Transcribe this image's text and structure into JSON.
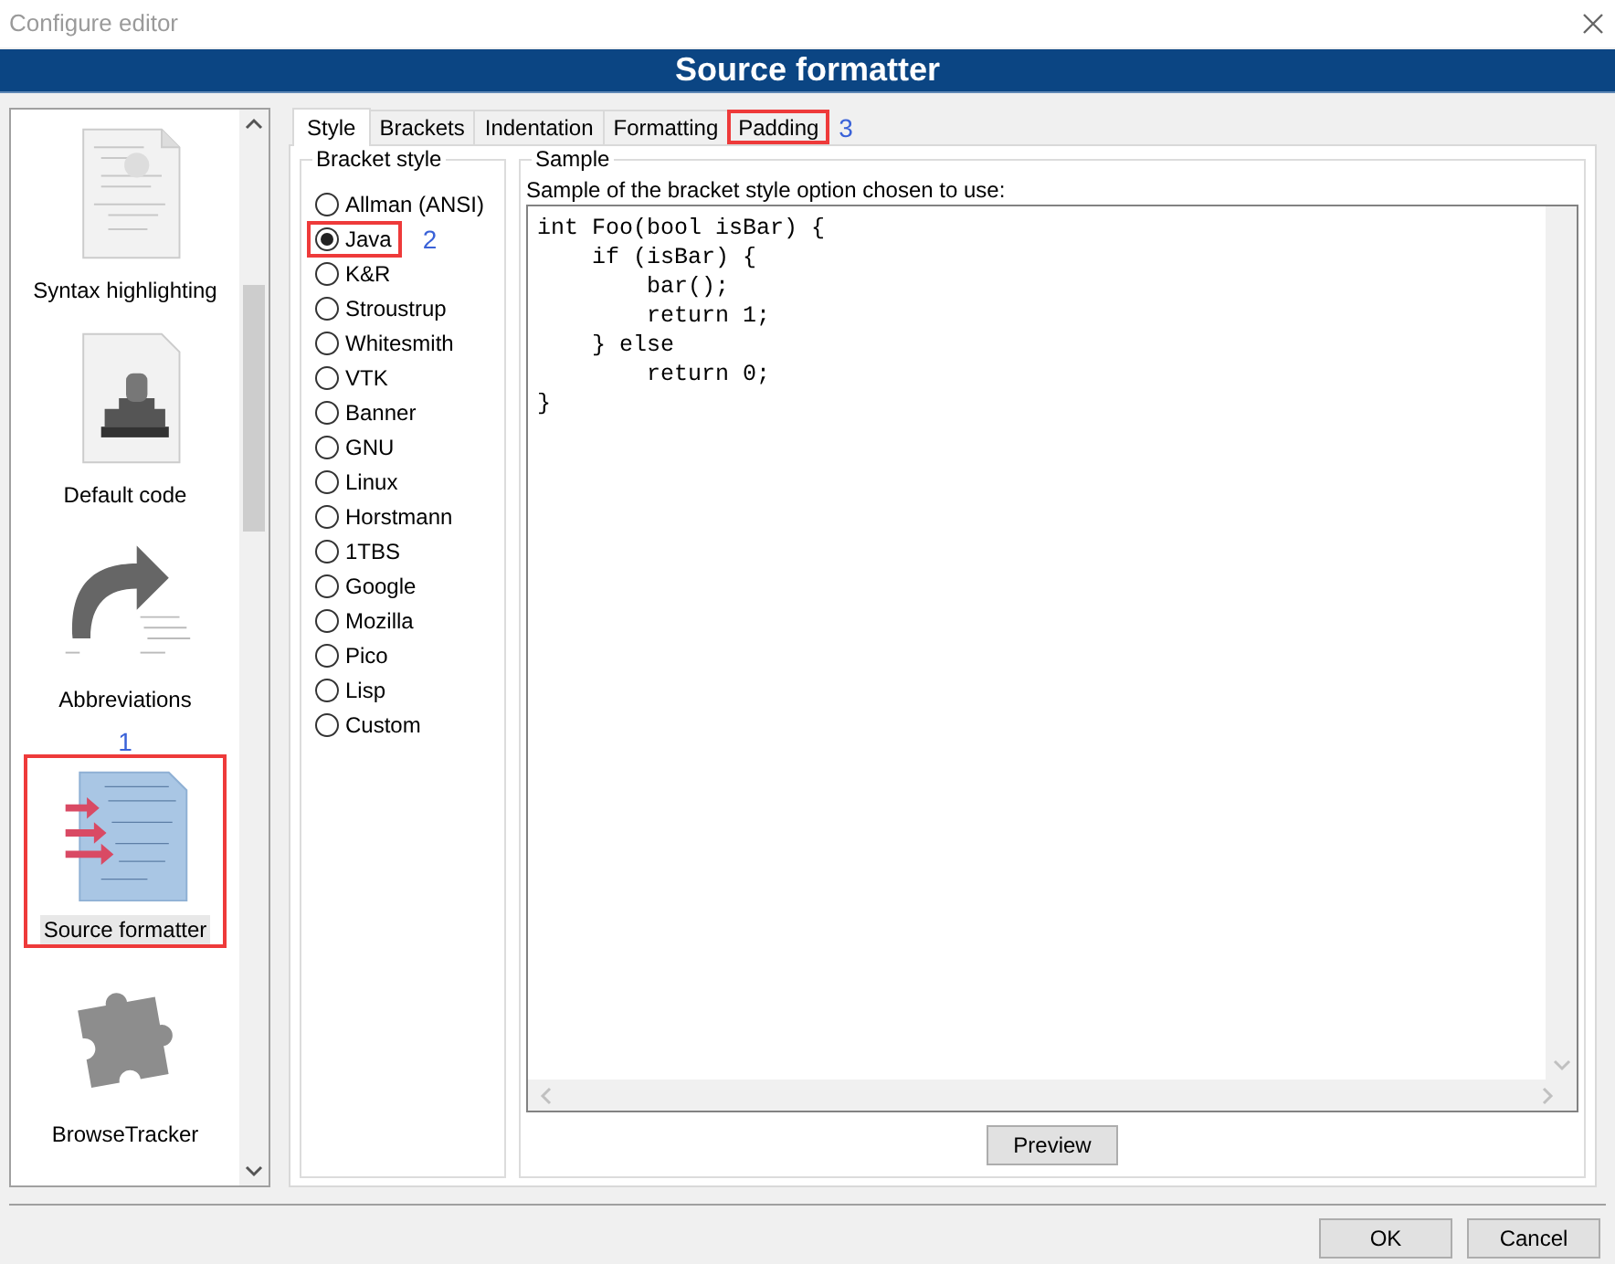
{
  "window": {
    "title": "Configure editor"
  },
  "header": {
    "title": "Source formatter"
  },
  "sidebar": {
    "items": [
      {
        "label": "Syntax highlighting",
        "selected": false,
        "highlighted": false
      },
      {
        "label": "Default code",
        "selected": false,
        "highlighted": false
      },
      {
        "label": "Abbreviations",
        "selected": false,
        "highlighted": false
      },
      {
        "label": "Source formatter",
        "selected": true,
        "highlighted": true,
        "callout": "1"
      },
      {
        "label": "BrowseTracker",
        "selected": false,
        "highlighted": false
      }
    ]
  },
  "tabs": [
    {
      "label": "Style",
      "selected": true,
      "highlighted": false
    },
    {
      "label": "Brackets",
      "selected": false,
      "highlighted": false
    },
    {
      "label": "Indentation",
      "selected": false,
      "highlighted": false
    },
    {
      "label": "Formatting",
      "selected": false,
      "highlighted": false
    },
    {
      "label": "Padding",
      "selected": false,
      "highlighted": true,
      "callout": "3"
    }
  ],
  "bracket_style": {
    "title": "Bracket style",
    "options": [
      {
        "label": "Allman (ANSI)",
        "selected": false,
        "highlighted": false
      },
      {
        "label": "Java",
        "selected": true,
        "highlighted": true,
        "callout": "2"
      },
      {
        "label": "K&R",
        "selected": false,
        "highlighted": false
      },
      {
        "label": "Stroustrup",
        "selected": false,
        "highlighted": false
      },
      {
        "label": "Whitesmith",
        "selected": false,
        "highlighted": false
      },
      {
        "label": "VTK",
        "selected": false,
        "highlighted": false
      },
      {
        "label": "Banner",
        "selected": false,
        "highlighted": false
      },
      {
        "label": "GNU",
        "selected": false,
        "highlighted": false
      },
      {
        "label": "Linux",
        "selected": false,
        "highlighted": false
      },
      {
        "label": "Horstmann",
        "selected": false,
        "highlighted": false
      },
      {
        "label": "1TBS",
        "selected": false,
        "highlighted": false
      },
      {
        "label": "Google",
        "selected": false,
        "highlighted": false
      },
      {
        "label": "Mozilla",
        "selected": false,
        "highlighted": false
      },
      {
        "label": "Pico",
        "selected": false,
        "highlighted": false
      },
      {
        "label": "Lisp",
        "selected": false,
        "highlighted": false
      },
      {
        "label": "Custom",
        "selected": false,
        "highlighted": false
      }
    ]
  },
  "sample": {
    "title": "Sample",
    "caption": "Sample of the bracket style option chosen to use:",
    "code": [
      "int Foo(bool isBar) {",
      "    if (isBar) {",
      "        bar();",
      "        return 1;",
      "    } else",
      "        return 0;",
      "}"
    ],
    "button": "Preview"
  },
  "buttons": [
    "OK",
    "Cancel"
  ]
}
